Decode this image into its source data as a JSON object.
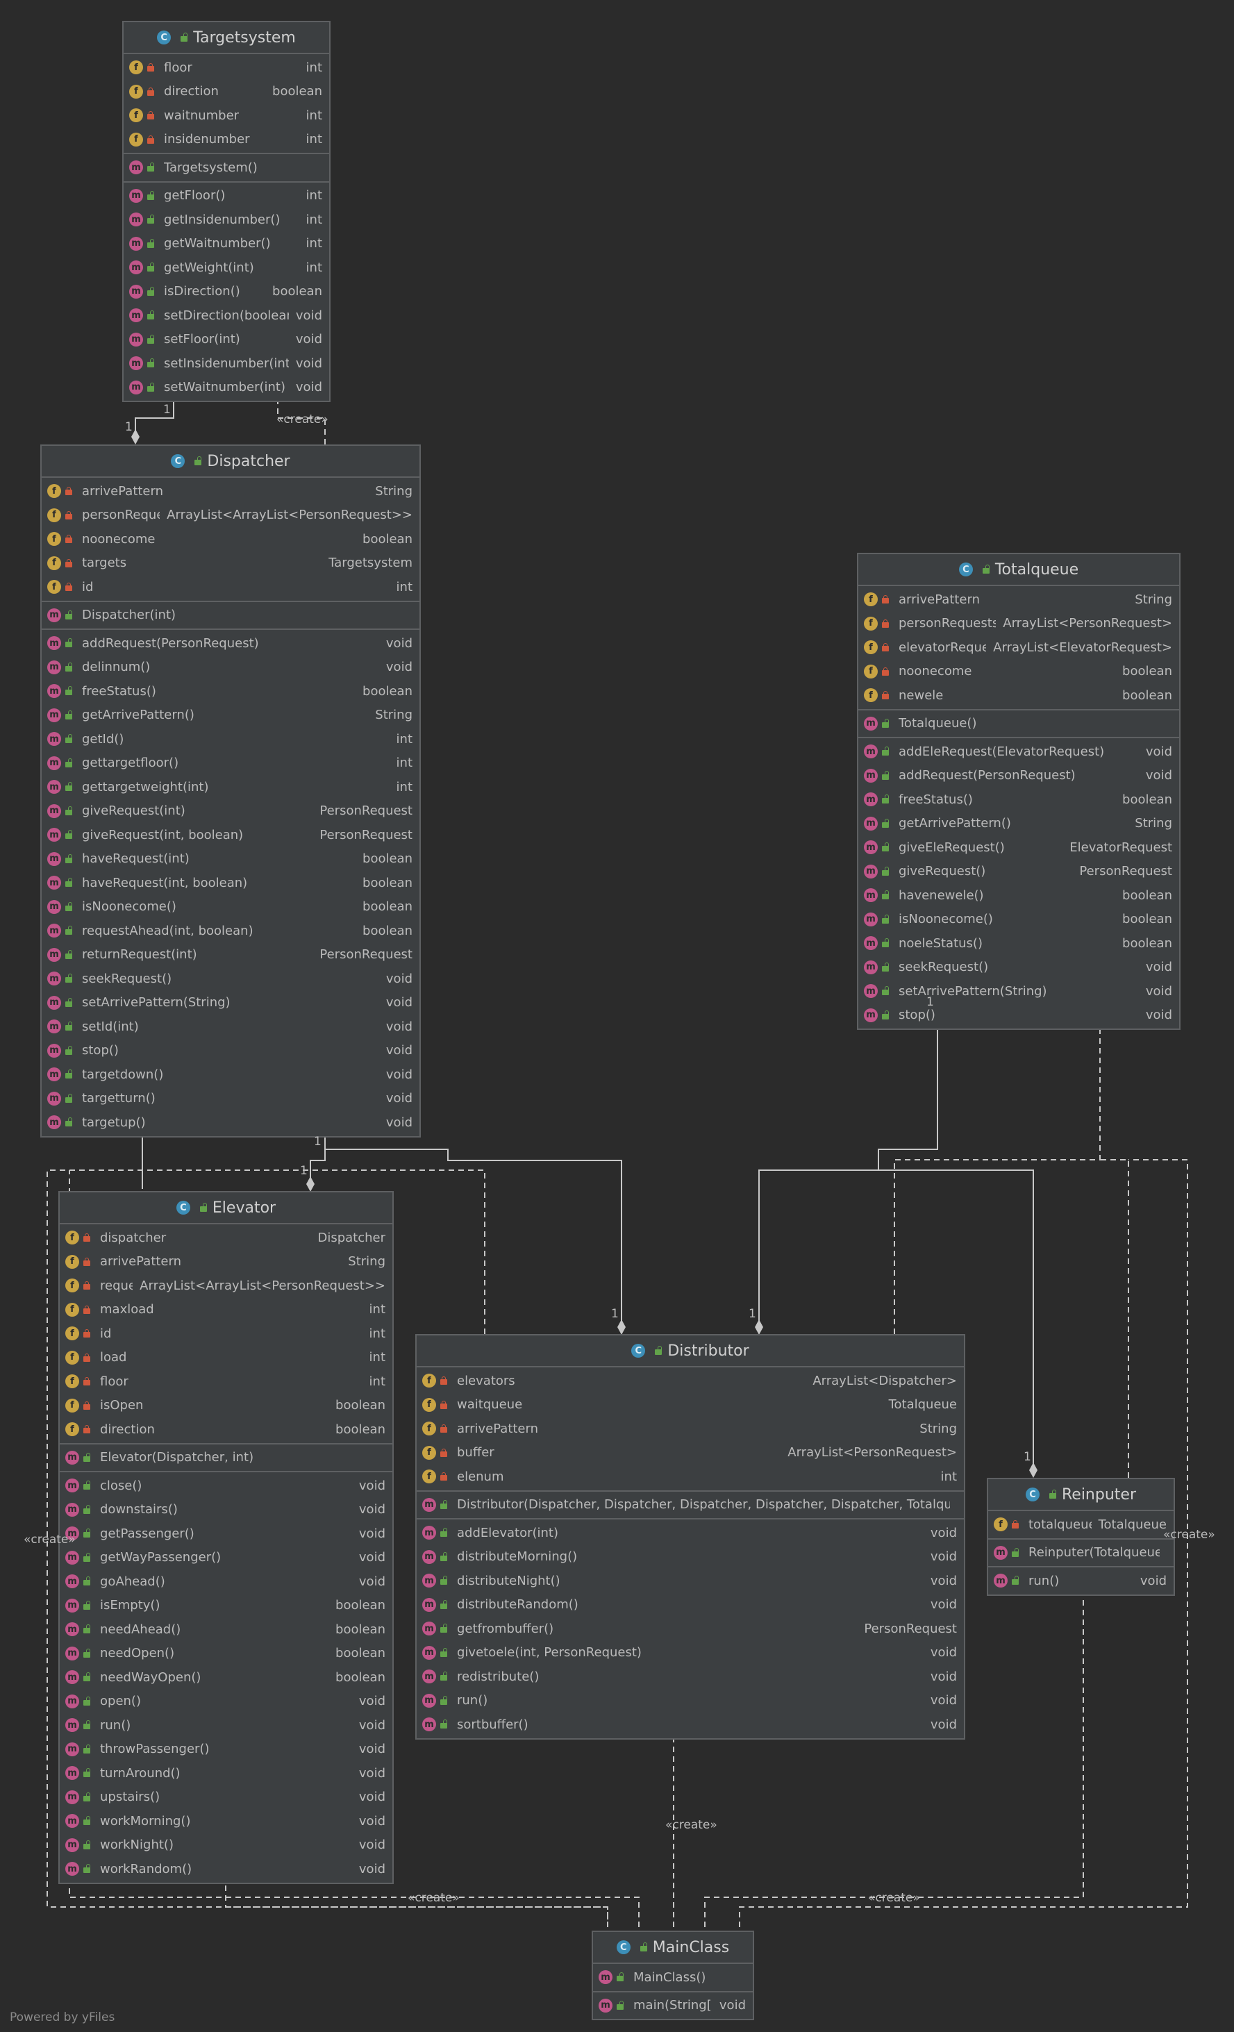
{
  "classes": [
    {
      "id": "targetsystem",
      "name": "Targetsystem",
      "fields": [
        [
          "floor",
          "int"
        ],
        [
          "direction",
          "boolean"
        ],
        [
          "waitnumber",
          "int"
        ],
        [
          "insidenumber",
          "int"
        ]
      ],
      "ctor": [
        [
          "Targetsystem()",
          ""
        ]
      ],
      "methods": [
        [
          "getFloor()",
          "int"
        ],
        [
          "getInsidenumber()",
          "int"
        ],
        [
          "getWaitnumber()",
          "int"
        ],
        [
          "getWeight(int)",
          "int"
        ],
        [
          "isDirection()",
          "boolean"
        ],
        [
          "setDirection(boolean)",
          "void"
        ],
        [
          "setFloor(int)",
          "void"
        ],
        [
          "setInsidenumber(int)",
          "void"
        ],
        [
          "setWaitnumber(int)",
          "void"
        ]
      ]
    },
    {
      "id": "dispatcher",
      "name": "Dispatcher",
      "fields": [
        [
          "arrivePattern",
          "String"
        ],
        [
          "personRequests",
          "ArrayList<ArrayList<PersonRequest>>"
        ],
        [
          "noonecome",
          "boolean"
        ],
        [
          "targets",
          "Targetsystem"
        ],
        [
          "id",
          "int"
        ]
      ],
      "ctor": [
        [
          "Dispatcher(int)",
          ""
        ]
      ],
      "methods": [
        [
          "addRequest(PersonRequest)",
          "void"
        ],
        [
          "delinnum()",
          "void"
        ],
        [
          "freeStatus()",
          "boolean"
        ],
        [
          "getArrivePattern()",
          "String"
        ],
        [
          "getId()",
          "int"
        ],
        [
          "gettargetfloor()",
          "int"
        ],
        [
          "gettargetweight(int)",
          "int"
        ],
        [
          "giveRequest(int)",
          "PersonRequest"
        ],
        [
          "giveRequest(int, boolean)",
          "PersonRequest"
        ],
        [
          "haveRequest(int)",
          "boolean"
        ],
        [
          "haveRequest(int, boolean)",
          "boolean"
        ],
        [
          "isNoonecome()",
          "boolean"
        ],
        [
          "requestAhead(int, boolean)",
          "boolean"
        ],
        [
          "returnRequest(int)",
          "PersonRequest"
        ],
        [
          "seekRequest()",
          "void"
        ],
        [
          "setArrivePattern(String)",
          "void"
        ],
        [
          "setId(int)",
          "void"
        ],
        [
          "stop()",
          "void"
        ],
        [
          "targetdown()",
          "void"
        ],
        [
          "targetturn()",
          "void"
        ],
        [
          "targetup()",
          "void"
        ]
      ]
    },
    {
      "id": "totalqueue",
      "name": "Totalqueue",
      "fields": [
        [
          "arrivePattern",
          "String"
        ],
        [
          "personRequests",
          "ArrayList<PersonRequest>"
        ],
        [
          "elevatorRequests",
          "ArrayList<ElevatorRequest>"
        ],
        [
          "noonecome",
          "boolean"
        ],
        [
          "newele",
          "boolean"
        ]
      ],
      "ctor": [
        [
          "Totalqueue()",
          ""
        ]
      ],
      "methods": [
        [
          "addEleRequest(ElevatorRequest)",
          "void"
        ],
        [
          "addRequest(PersonRequest)",
          "void"
        ],
        [
          "freeStatus()",
          "boolean"
        ],
        [
          "getArrivePattern()",
          "String"
        ],
        [
          "giveEleRequest()",
          "ElevatorRequest"
        ],
        [
          "giveRequest()",
          "PersonRequest"
        ],
        [
          "havenewele()",
          "boolean"
        ],
        [
          "isNoonecome()",
          "boolean"
        ],
        [
          "noeleStatus()",
          "boolean"
        ],
        [
          "seekRequest()",
          "void"
        ],
        [
          "setArrivePattern(String)",
          "void"
        ],
        [
          "stop()",
          "void"
        ]
      ]
    },
    {
      "id": "elevator",
      "name": "Elevator",
      "fields": [
        [
          "dispatcher",
          "Dispatcher"
        ],
        [
          "arrivePattern",
          "String"
        ],
        [
          "requests",
          "ArrayList<ArrayList<PersonRequest>>"
        ],
        [
          "maxload",
          "int"
        ],
        [
          "id",
          "int"
        ],
        [
          "load",
          "int"
        ],
        [
          "floor",
          "int"
        ],
        [
          "isOpen",
          "boolean"
        ],
        [
          "direction",
          "boolean"
        ]
      ],
      "ctor": [
        [
          "Elevator(Dispatcher, int)",
          ""
        ]
      ],
      "methods": [
        [
          "close()",
          "void"
        ],
        [
          "downstairs()",
          "void"
        ],
        [
          "getPassenger()",
          "void"
        ],
        [
          "getWayPassenger()",
          "void"
        ],
        [
          "goAhead()",
          "void"
        ],
        [
          "isEmpty()",
          "boolean"
        ],
        [
          "needAhead()",
          "boolean"
        ],
        [
          "needOpen()",
          "boolean"
        ],
        [
          "needWayOpen()",
          "boolean"
        ],
        [
          "open()",
          "void"
        ],
        [
          "run()",
          "void"
        ],
        [
          "throwPassenger()",
          "void"
        ],
        [
          "turnAround()",
          "void"
        ],
        [
          "upstairs()",
          "void"
        ],
        [
          "workMorning()",
          "void"
        ],
        [
          "workNight()",
          "void"
        ],
        [
          "workRandom()",
          "void"
        ]
      ]
    },
    {
      "id": "distributor",
      "name": "Distributor",
      "fields": [
        [
          "elevators",
          "ArrayList<Dispatcher>"
        ],
        [
          "waitqueue",
          "Totalqueue"
        ],
        [
          "arrivePattern",
          "String"
        ],
        [
          "buffer",
          "ArrayList<PersonRequest>"
        ],
        [
          "elenum",
          "int"
        ]
      ],
      "ctor": [
        [
          "Distributor(Dispatcher, Dispatcher, Dispatcher, Dispatcher, Dispatcher, Totalqueue)",
          ""
        ]
      ],
      "methods": [
        [
          "addElevator(int)",
          "void"
        ],
        [
          "distributeMorning()",
          "void"
        ],
        [
          "distributeNight()",
          "void"
        ],
        [
          "distributeRandom()",
          "void"
        ],
        [
          "getfrombuffer()",
          "PersonRequest"
        ],
        [
          "givetoele(int, PersonRequest)",
          "void"
        ],
        [
          "redistribute()",
          "void"
        ],
        [
          "run()",
          "void"
        ],
        [
          "sortbuffer()",
          "void"
        ]
      ]
    },
    {
      "id": "reinputer",
      "name": "Reinputer",
      "fields": [
        [
          "totalqueue",
          "Totalqueue"
        ]
      ],
      "ctor": [
        [
          "Reinputer(Totalqueue)",
          ""
        ]
      ],
      "methods": [
        [
          "run()",
          "void"
        ]
      ]
    },
    {
      "id": "mainclass",
      "name": "MainClass",
      "fields": [],
      "ctor": [
        [
          "MainClass()",
          ""
        ]
      ],
      "methods": [
        [
          "main(String[])",
          "void"
        ]
      ]
    }
  ],
  "edge_labels": {
    "create": "«create»",
    "one": "1"
  },
  "icons": {
    "class": "C",
    "field": "f",
    "method": "m"
  },
  "colors": {
    "background": "#2b2b2b",
    "box": "#3c3f41",
    "border": "#5e6062",
    "edge": "#c8c8c8"
  },
  "watermark": "Powered by yFiles"
}
